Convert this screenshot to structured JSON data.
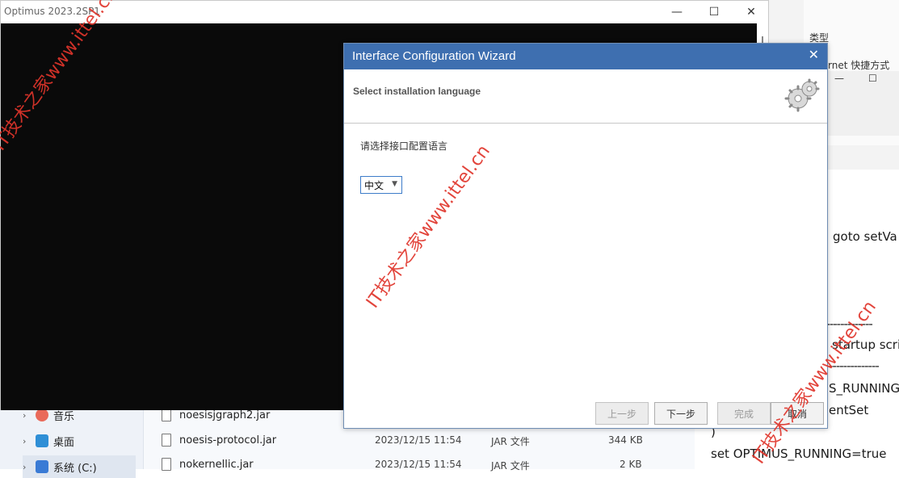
{
  "optimus_window": {
    "title": "Optimus 2023.2SP1",
    "min_glyph": "—",
    "max_glyph": "☐",
    "close_glyph": "✕"
  },
  "wizard": {
    "title": "Interface Configuration Wizard",
    "close_glyph": "✕",
    "header": "Select installation language",
    "prompt": "请选择接口配置语言",
    "language_selected": "中文",
    "buttons": {
      "back": "上一步",
      "next": "下一步",
      "finish": "完成",
      "cancel": "取消"
    },
    "accent_color": "#3e6fb0"
  },
  "right_panel": {
    "type_label": "类型",
    "shortcut_label": "rnet 快捷方式",
    "min_glyph": "—",
    "max_glyph": "☐"
  },
  "editor_lines": [
    "goto setVa",
    "--------------",
    "startup scri",
    "--------------",
    "S_RUNNING",
    "entSet",
    ")",
    "set OPTIMUS_RUNNING=true"
  ],
  "explorer": {
    "nav_items": [
      {
        "label": "音乐"
      },
      {
        "label": "桌面"
      },
      {
        "label": "系统 (C:)"
      }
    ],
    "files": [
      {
        "name": "noesisjgraph2.jar",
        "date": "",
        "type": "",
        "size": ""
      },
      {
        "name": "noesis-protocol.jar",
        "date": "2023/12/15 11:54",
        "type": "JAR 文件",
        "size": "344 KB"
      },
      {
        "name": "nokernellic.jar",
        "date": "2023/12/15 11:54",
        "type": "JAR 文件",
        "size": "2 KB"
      }
    ]
  },
  "watermark_text": "IT技术之家www.ittel.cn"
}
